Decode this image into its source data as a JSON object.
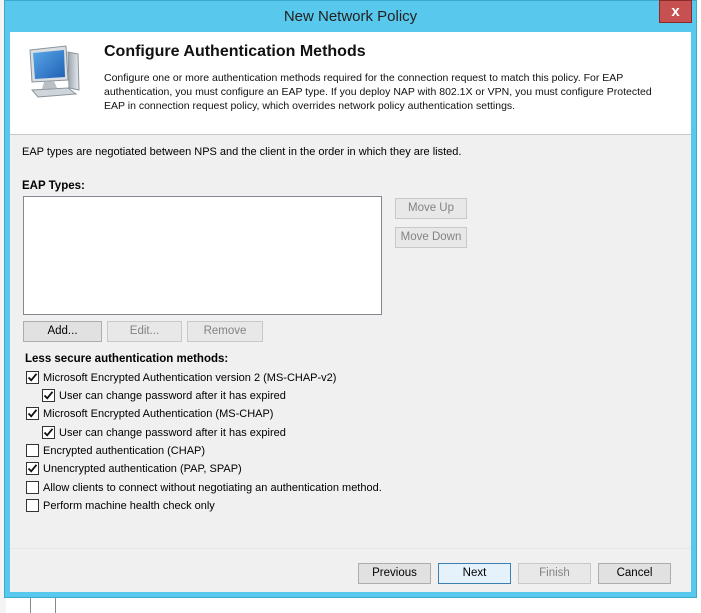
{
  "window": {
    "title": "New Network Policy",
    "close_glyph": "x"
  },
  "header": {
    "icon": "monitor-icon",
    "title": "Configure Authentication Methods",
    "description": "Configure one or more authentication methods required for the connection request to match this policy. For EAP authentication, you must configure an EAP type. If you deploy NAP with 802.1X or VPN, you must configure Protected EAP in connection request policy, which overrides network policy authentication settings."
  },
  "eap": {
    "intro": "EAP types are negotiated between NPS and the client in the order in which they are listed.",
    "label": "EAP Types:",
    "items": [],
    "move_up": "Move Up",
    "move_down": "Move Down",
    "add": "Add...",
    "edit": "Edit...",
    "remove": "Remove"
  },
  "less_secure": {
    "label": "Less secure authentication methods:",
    "options": [
      {
        "label": "Microsoft Encrypted Authentication version 2 (MS-CHAP-v2)",
        "checked": true
      },
      {
        "label": "User can change password after it has expired",
        "checked": true
      },
      {
        "label": "Microsoft Encrypted Authentication (MS-CHAP)",
        "checked": true
      },
      {
        "label": "User can change password after it has expired",
        "checked": true
      },
      {
        "label": "Encrypted authentication (CHAP)",
        "checked": false
      },
      {
        "label": "Unencrypted authentication (PAP, SPAP)",
        "checked": true
      },
      {
        "label": "Allow clients to connect without negotiating an authentication method.",
        "checked": false
      },
      {
        "label": "Perform machine health check only",
        "checked": false
      }
    ]
  },
  "footer": {
    "previous": "Previous",
    "next": "Next",
    "finish": "Finish",
    "cancel": "Cancel"
  },
  "colors": {
    "title_bar": "#58c8ec",
    "close_button": "#c75050",
    "client_bg": "#f0f0f0"
  }
}
